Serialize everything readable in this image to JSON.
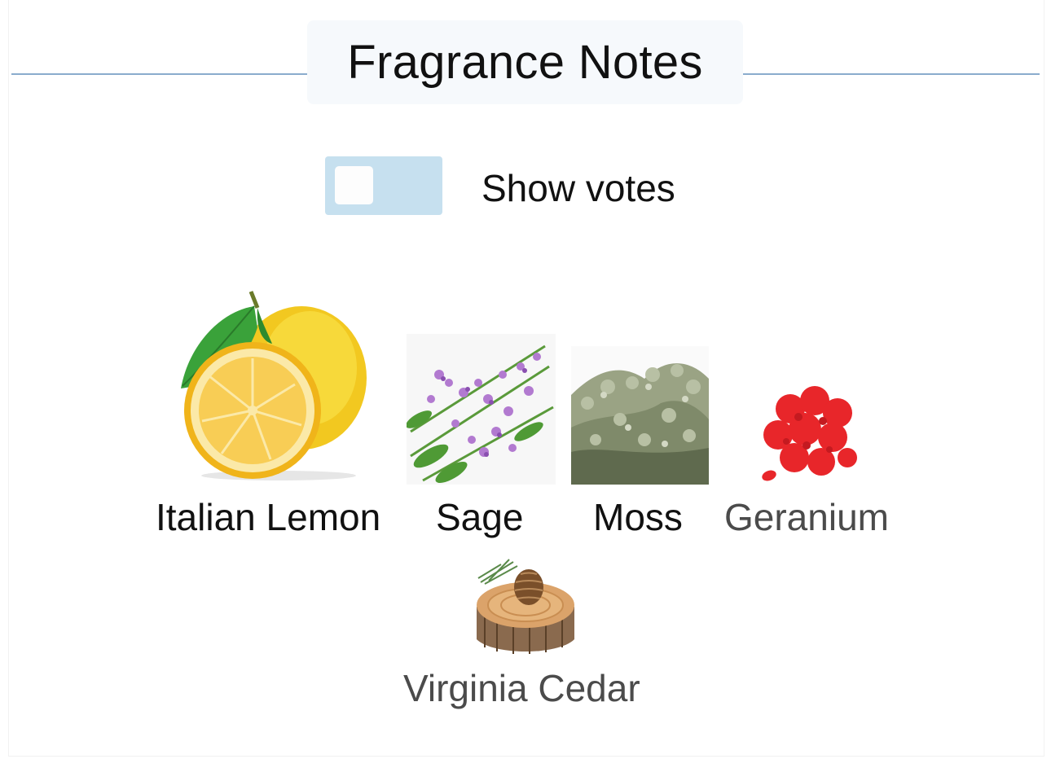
{
  "header": {
    "title": "Fragrance Notes"
  },
  "toggle": {
    "label": "Show votes",
    "on": false
  },
  "notes": [
    {
      "name": "Italian Lemon",
      "icon": "lemon-icon"
    },
    {
      "name": "Sage",
      "icon": "sage-icon"
    },
    {
      "name": "Moss",
      "icon": "moss-icon"
    },
    {
      "name": "Geranium",
      "icon": "geranium-icon"
    },
    {
      "name": "Virginia Cedar",
      "icon": "cedar-icon"
    }
  ],
  "colors": {
    "rule": "#8aaccd",
    "toggle_track": "#c6e0ef",
    "title_bg": "#f6f9fc"
  }
}
